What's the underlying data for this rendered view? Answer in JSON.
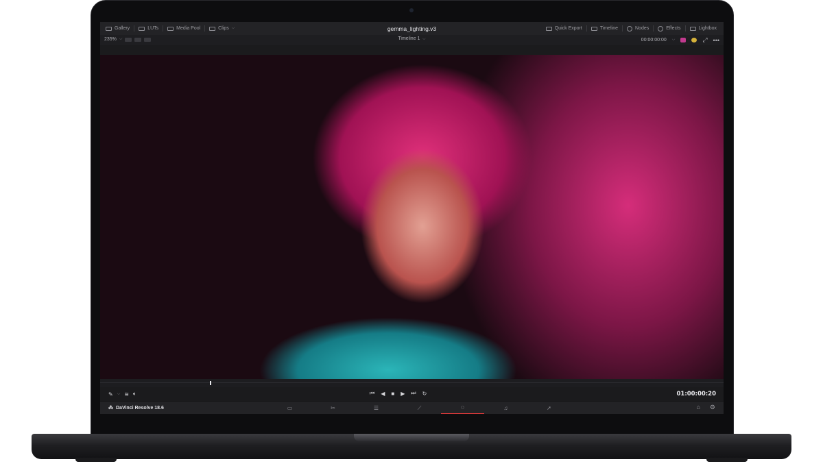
{
  "topbar": {
    "left_items": [
      "Gallery",
      "LUTs",
      "Media Pool",
      "Clips"
    ],
    "project_title": "gemma_lighting.v3",
    "right_items": [
      "Quick Export",
      "Timeline",
      "Nodes",
      "Effects",
      "Lightbox"
    ]
  },
  "viewer": {
    "zoom": "235%",
    "timeline_name": "Timeline 1",
    "timecode_top": "00:00:00:00"
  },
  "transport": {
    "timecode": "01:00:00:20"
  },
  "pagebar": {
    "app_name": "DaVinci Resolve 18.6",
    "active_page": "color"
  },
  "colors": {
    "accent": "#e03a3a"
  }
}
